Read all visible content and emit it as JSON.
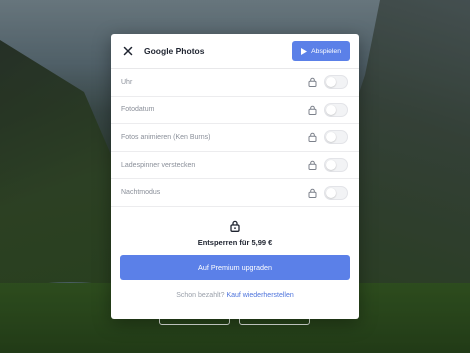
{
  "modal": {
    "title": "Google Photos",
    "play_label": "Abspielen",
    "settings": [
      {
        "label": "Uhr",
        "enabled": false,
        "locked": true
      },
      {
        "label": "Fotodatum",
        "enabled": false,
        "locked": true
      },
      {
        "label": "Fotos animieren (Ken Burns)",
        "enabled": false,
        "locked": true
      },
      {
        "label": "Ladespinner verstecken",
        "enabled": false,
        "locked": true
      },
      {
        "label": "Nachtmodus",
        "enabled": false,
        "locked": true
      }
    ],
    "unlock_text": "Entsperren für 5,99 €",
    "upgrade_label": "Auf Premium upgraden",
    "restore_question": "Schon bezahlt?",
    "restore_link": "Kauf wiederherstellen"
  },
  "icons": {
    "close": "close-icon",
    "play": "play-icon",
    "lock": "lock-icon"
  },
  "colors": {
    "accent": "#5b80e8",
    "link": "#4e74dc",
    "title": "#1f2430",
    "label": "#8a8f99"
  }
}
